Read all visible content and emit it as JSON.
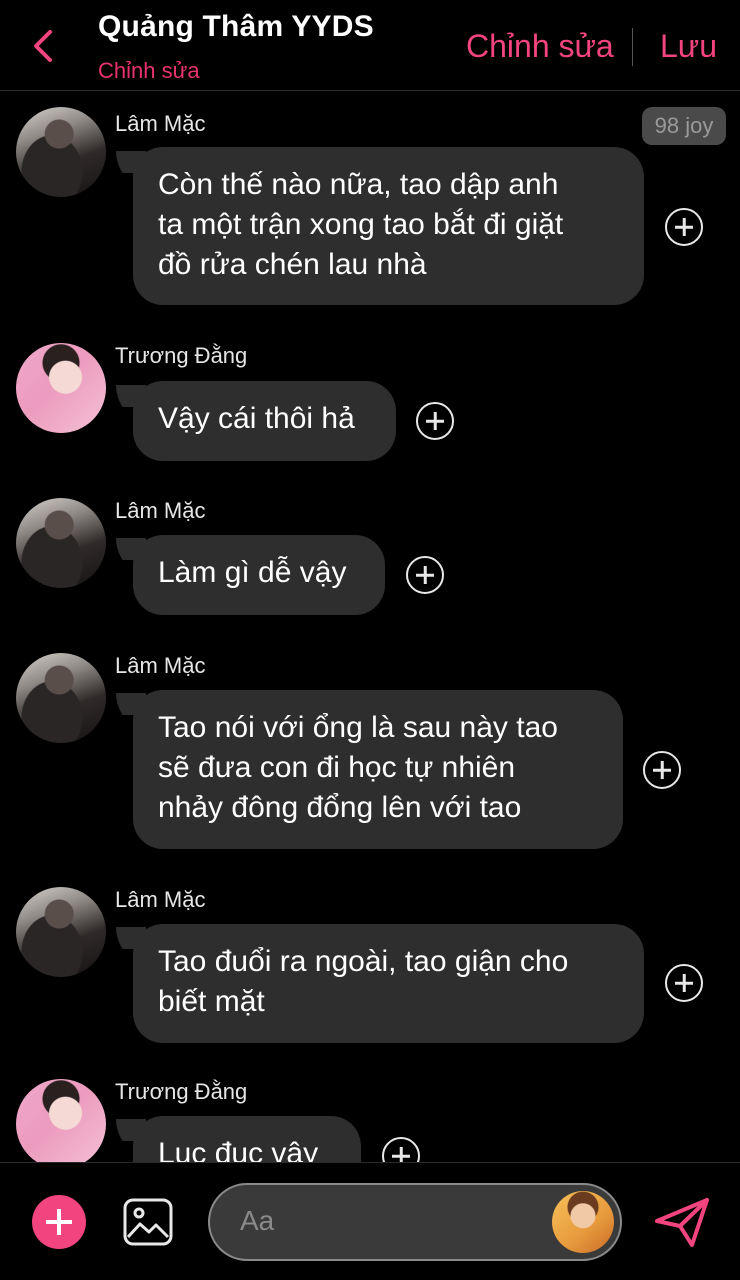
{
  "header": {
    "title": "Quảng Thâm YYDS",
    "subtitle": "Chỉnh sửa",
    "edit_label": "Chỉnh sửa",
    "save_label": "Lưu"
  },
  "badge": {
    "text": "98 joy"
  },
  "messages": [
    {
      "sender": "Lâm Mặc",
      "avatar": "lam",
      "lines": [
        "Còn thế nào nữa, tao dập anh",
        "ta một trận xong tao bắt đi giặt",
        "đồ rửa chén lau nhà"
      ]
    },
    {
      "sender": "Trương Đằng",
      "avatar": "truong",
      "lines": [
        "Vậy cái thôi hả"
      ]
    },
    {
      "sender": "Lâm Mặc",
      "avatar": "lam",
      "lines": [
        "Làm gì dễ vậy"
      ]
    },
    {
      "sender": "Lâm Mặc",
      "avatar": "lam",
      "lines": [
        "Tao nói với ổng là sau này tao",
        "sẽ đưa con đi học tự nhiên",
        "nhảy đông đổng lên với tao"
      ]
    },
    {
      "sender": "Lâm Mặc",
      "avatar": "lam",
      "lines": [
        "Tao đuổi ra ngoài, tao giận cho",
        "biết mặt"
      ]
    },
    {
      "sender": "Trương Đằng",
      "avatar": "truong",
      "lines": [
        "Lục đục vậy"
      ]
    }
  ],
  "composer": {
    "placeholder": "Aa"
  },
  "colors": {
    "accent": "#f2447e",
    "bubble": "#2e2e2e",
    "background": "#000000"
  },
  "icons": [
    "back-chevron-icon",
    "plus-circle-icon",
    "image-icon",
    "send-icon"
  ]
}
